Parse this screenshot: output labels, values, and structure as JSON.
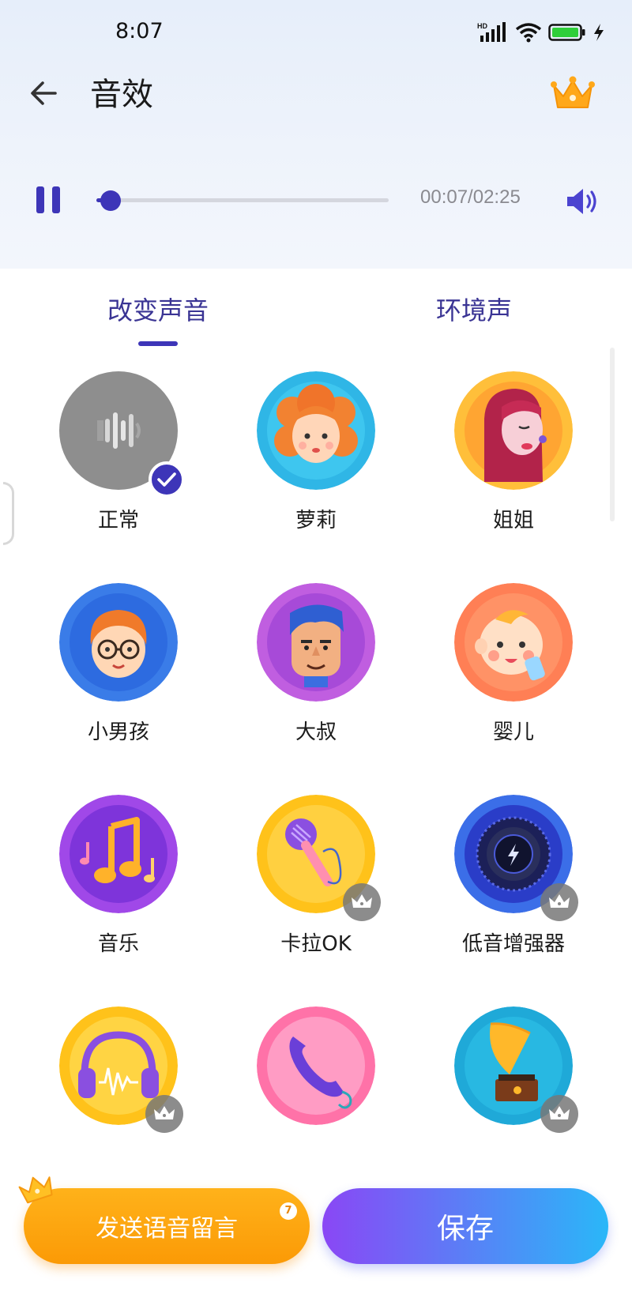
{
  "status_bar": {
    "time": "8:07",
    "network_label": "HD"
  },
  "app_bar": {
    "title": "音效",
    "back_icon": "back-arrow-icon",
    "vip_icon": "crown-icon"
  },
  "player": {
    "state_icon": "pause-icon",
    "elapsed": "00:07",
    "duration": "02:25",
    "time_text": "00:07/02:25",
    "progress": 0.048,
    "volume_icon": "volume-icon"
  },
  "tabs": [
    {
      "label": "改变声音",
      "active": true
    },
    {
      "label": "环境声",
      "active": false
    }
  ],
  "effects": [
    {
      "label": "正常",
      "icon": "sound-wave-icon",
      "selected": true,
      "vip": false
    },
    {
      "label": "萝莉",
      "icon": "girl-face-icon",
      "selected": false,
      "vip": false
    },
    {
      "label": "姐姐",
      "icon": "woman-face-icon",
      "selected": false,
      "vip": false
    },
    {
      "label": "小男孩",
      "icon": "boy-face-icon",
      "selected": false,
      "vip": false
    },
    {
      "label": "大叔",
      "icon": "man-face-icon",
      "selected": false,
      "vip": false
    },
    {
      "label": "婴儿",
      "icon": "baby-face-icon",
      "selected": false,
      "vip": false
    },
    {
      "label": "音乐",
      "icon": "music-notes-icon",
      "selected": false,
      "vip": false
    },
    {
      "label": "卡拉OK",
      "icon": "microphone-icon",
      "selected": false,
      "vip": true
    },
    {
      "label": "低音增强器",
      "icon": "bass-knob-icon",
      "selected": false,
      "vip": true
    },
    {
      "label": "",
      "icon": "headphones-icon",
      "selected": false,
      "vip": true
    },
    {
      "label": "",
      "icon": "telephone-icon",
      "selected": false,
      "vip": false
    },
    {
      "label": "",
      "icon": "gramophone-icon",
      "selected": false,
      "vip": true
    }
  ],
  "bottom": {
    "voicemail_button": "发送语音留言",
    "voicemail_badge": "7",
    "save_button": "保存"
  },
  "colors": {
    "accent": "#3d35b8",
    "orange": "#fb9a06",
    "save_start": "#8a47f5",
    "save_end": "#2ab7f8"
  }
}
